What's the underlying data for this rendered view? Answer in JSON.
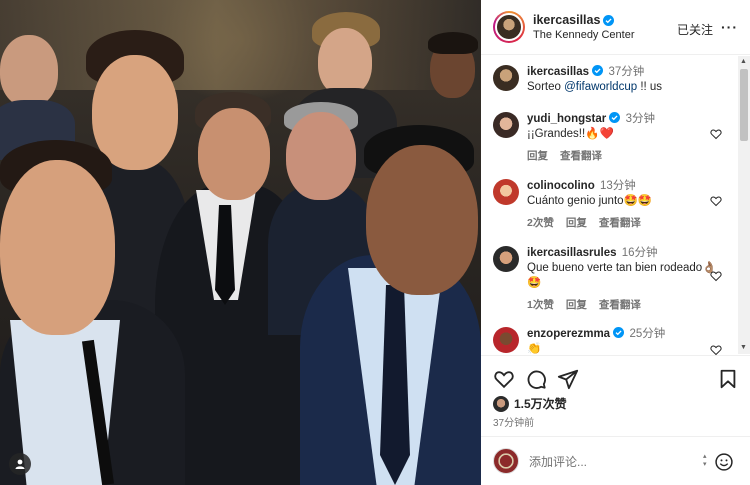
{
  "post": {
    "author": "ikercasillas",
    "location": "The Kennedy Center",
    "follow_label": "已关注",
    "more_label": "···"
  },
  "caption": {
    "author": "ikercasillas",
    "time": "37分钟",
    "text_before": "Sorteo ",
    "mention": "@fifaworldcup",
    "text_after": " !! us"
  },
  "comments": [
    {
      "user": "yudi_hongstar",
      "time": "3分钟",
      "text": "¡¡Grandes!!🔥❤️",
      "likes": "",
      "reply": "回复",
      "translate": "查看翻译"
    },
    {
      "user": "colinocolino",
      "time": "13分钟",
      "text": "Cuánto genio junto🤩🤩",
      "likes": "2次赞",
      "reply": "回复",
      "translate": "查看翻译"
    },
    {
      "user": "ikercasillasrules",
      "time": "16分钟",
      "text": "Que bueno verte tan bien rodeado👌🏽🤩",
      "likes": "1次赞",
      "reply": "回复",
      "translate": "查看翻译"
    },
    {
      "user": "enzoperezmma",
      "time": "25分钟",
      "text": "👏"
    }
  ],
  "engagement": {
    "likes_count": "1.5万次赞",
    "posted_ago": "37分钟前"
  },
  "composer": {
    "placeholder": "添加评论..."
  },
  "colors": {
    "link": "#00376b",
    "verified": "#0095f6",
    "muted": "#737373"
  }
}
